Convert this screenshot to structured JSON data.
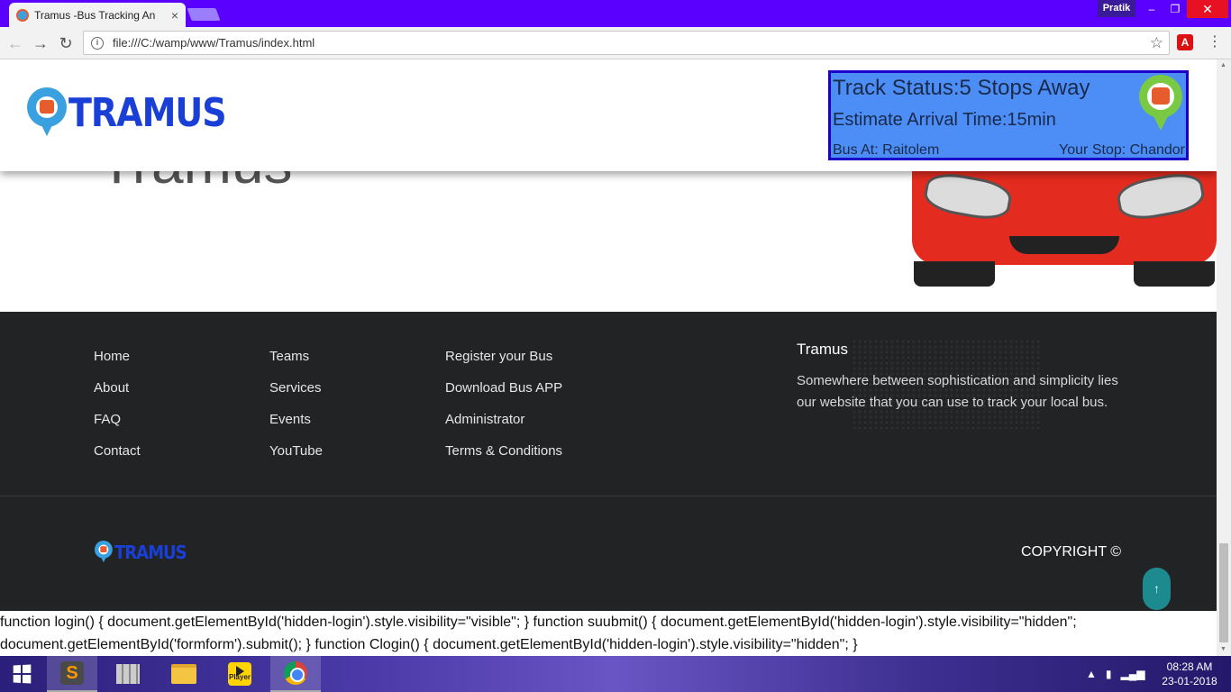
{
  "browser": {
    "tab_title": "Tramus -Bus Tracking An",
    "tab_close": "×",
    "user": "Pratik",
    "url": "file:///C:/wamp/www/Tramus/index.html",
    "win_min": "–",
    "win_max": "❐",
    "win_close": "✕",
    "back": "←",
    "forward": "→",
    "reload": "↻",
    "info": "i",
    "star": "☆",
    "ext": "A",
    "menu": "⋮"
  },
  "header": {
    "logo_text": "TRAMUS",
    "track_status": "Track Status:5 Stops Away",
    "estimate_arrival": "Estimate Arrival Time:15min",
    "bus_at": "Bus At: Raitolem",
    "your_stop": "Your Stop: Chandor"
  },
  "hero": {
    "ghost_title": "Tramus"
  },
  "footer": {
    "col1": [
      "Home",
      "About",
      "FAQ",
      "Contact"
    ],
    "col2": [
      "Teams",
      "Services",
      "Events",
      "YouTube"
    ],
    "col3": [
      "Register your Bus",
      "Download Bus APP",
      "Administrator",
      "Terms & Conditions"
    ],
    "about_title": "Tramus",
    "about_text": "Somewhere between sophistication and simplicity lies our website that you can use to track your local bus.",
    "logo_text": "TRAMUS",
    "copyright": "COPYRIGHT ©",
    "to_top": "↑"
  },
  "script_text": "function login() { document.getElementById('hidden-login').style.visibility=\"visible\"; } function suubmit() { document.getElementById('hidden-login').style.visibility=\"hidden\"; document.getElementById('formform').submit(); } function Clogin() { document.getElementById('hidden-login').style.visibility=\"hidden\"; }",
  "taskbar": {
    "player_label": "Player",
    "time": "08:28 AM",
    "date": "23-01-2018"
  }
}
